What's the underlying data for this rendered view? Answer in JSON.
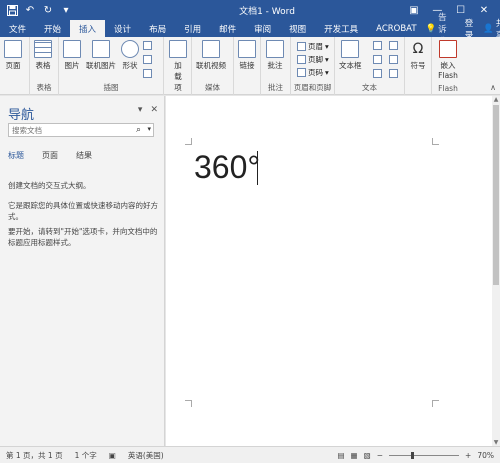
{
  "titlebar": {
    "title": "文档1 - Word",
    "qat": [
      "save-icon",
      "undo-icon",
      "redo-icon",
      "customize-icon"
    ],
    "controls": {
      "ribbon_display": "▣",
      "minimize": "—",
      "maximize": "☐",
      "close": "✕"
    }
  },
  "tabs": {
    "items": [
      {
        "label": "文件"
      },
      {
        "label": "开始"
      },
      {
        "label": "插入",
        "active": true
      },
      {
        "label": "设计"
      },
      {
        "label": "布局"
      },
      {
        "label": "引用"
      },
      {
        "label": "邮件"
      },
      {
        "label": "审阅"
      },
      {
        "label": "视图"
      },
      {
        "label": "开发工具"
      },
      {
        "label": "ACROBAT"
      }
    ],
    "tell_me": "告诉我...",
    "signin": "登录",
    "share": "共享"
  },
  "ribbon": {
    "pages": "页面",
    "table": "表格",
    "table_group": "表格",
    "picture": "图片",
    "online_picture": "联机图片",
    "shapes": "形状",
    "illustrations_group": "插图",
    "addins": "加载项",
    "online_video": "联机视频",
    "media_group": "媒体",
    "link": "链接",
    "comment": "批注",
    "comment_group": "批注",
    "header": "页眉",
    "footer": "页脚",
    "page_number": "页码",
    "header_footer_group": "页眉和页脚",
    "textbox": "文本框",
    "text_group": "文本",
    "symbol": "符号",
    "embed_flash": "嵌入 Flash",
    "flash_group": "Flash"
  },
  "nav": {
    "title": "导航",
    "search_placeholder": "搜索文档",
    "tabs": [
      "标题",
      "页面",
      "结果"
    ],
    "text1": "创建文档的交互式大纲。",
    "text2": "它是跟踪您的具体位置或快速移动内容的好方式。",
    "text3": "要开始，请转到\"开始\"选项卡，并向文档中的标题应用标题样式。"
  },
  "document": {
    "content": "360°"
  },
  "status": {
    "page": "第 1 页，共 1 页",
    "words": "1 个字",
    "language": "英语(美国)",
    "zoom": "70%",
    "zoom_level": 0.7
  }
}
